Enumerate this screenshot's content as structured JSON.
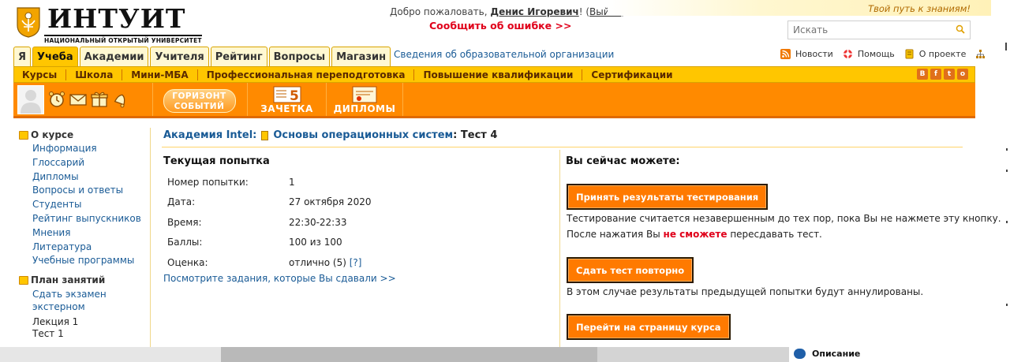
{
  "header": {
    "logo_name": "ИНТУИТ",
    "logo_sub": "НАЦИОНАЛЬНЫЙ ОТКРЫТЫЙ УНИВЕРСИТЕТ",
    "welcome_prefix": "Добро пожаловать, ",
    "user_name": "Денис Игоревич",
    "welcome_mid": "! (",
    "logout": "Выйти",
    "welcome_suffix": ")",
    "report_error": "Сообщить об ошибке >>",
    "slogan": "Твой путь к знаниям!",
    "search_placeholder": "Искать"
  },
  "tabs": [
    {
      "label": "Я"
    },
    {
      "label": "Учеба",
      "active": true
    },
    {
      "label": "Академии"
    },
    {
      "label": "Учителя"
    },
    {
      "label": "Рейтинг"
    },
    {
      "label": "Вопросы"
    },
    {
      "label": "Магазин"
    }
  ],
  "org_info": "Сведения об образовательной организации",
  "toplinks": {
    "news": "Новости",
    "help": "Помощь",
    "about": "О проекте"
  },
  "subnav": [
    "Курсы",
    "Школа",
    "Мини-МБА",
    "Профессиональная переподготовка",
    "Повышение квалификации",
    "Сертификации"
  ],
  "social": [
    "В",
    "f",
    "t",
    "о"
  ],
  "orangebar": {
    "horizon": "ГОРИЗОНТ СОБЫТИЙ",
    "zachetka": "ЗАЧЕТКА",
    "zachetka_grade": "5",
    "diplomy": "ДИПЛОМЫ"
  },
  "sidebar": {
    "about_title": "О курсе",
    "about_links": [
      "Информация",
      "Глоссарий",
      "Дипломы",
      "Вопросы и ответы",
      "Студенты",
      "Рейтинг выпускников",
      "Мнения",
      "Литература",
      "Учебные программы"
    ],
    "plan_title": "План занятий",
    "plan_link": "Сдать экзамен экстерном",
    "plan_items": [
      "Лекция 1",
      "Тест 1"
    ]
  },
  "breadcrumb": {
    "academy": "Академия Intel:",
    "course": "Основы операционных систем",
    "current": ": Тест 4"
  },
  "attempt": {
    "title": "Текущая попытка",
    "rows": [
      {
        "k": "Номер попытки:",
        "v": "1"
      },
      {
        "k": "Дата:",
        "v": "27 октября 2020"
      },
      {
        "k": "Время:",
        "v": "22:30-22:33"
      },
      {
        "k": "Баллы:",
        "v": "100 из 100"
      },
      {
        "k": "Оценка:",
        "v": "отлично (5) ",
        "q": "[?]"
      }
    ],
    "tasks_link": "Посмотрите задания, которые Вы сдавали >>"
  },
  "actions": {
    "title": "Вы сейчас можете:",
    "accept": "Принять результаты тестирования",
    "accept_note": "Тестирование считается незавершенным до тех пор, пока Вы не нажмете эту кнопку.",
    "after_prefix": "После нажатия Вы ",
    "after_red": "не сможете",
    "after_suffix": " пересдавать тест.",
    "retake": "Сдать тест повторно",
    "retake_note": "В этом случае результаты предыдущей попытки будут аннулированы.",
    "goto_course": "Перейти на страницу курса"
  },
  "description": "Описание",
  "colors": {
    "accent_orange": "#ff8a00",
    "tab_yellow": "#ffc600",
    "link_blue": "#1a5b96",
    "alert_red": "#e0001a"
  }
}
